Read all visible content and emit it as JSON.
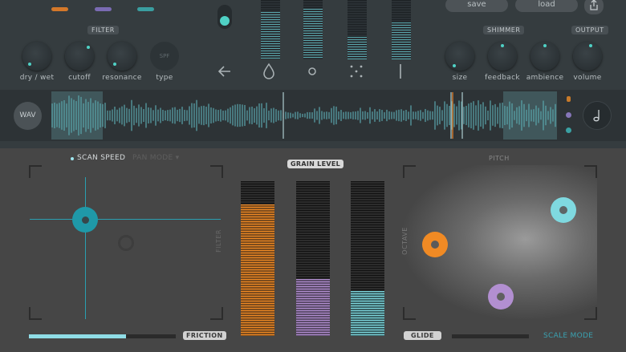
{
  "colors": {
    "teal": "#4fd1c5",
    "orange": "#f08a24",
    "lilac": "#b28fd1",
    "cyan": "#7fd9e0",
    "blue": "#1f99a8"
  },
  "top_tabs": [
    {
      "color": "#d4782a"
    },
    {
      "color": "#7a6bb3"
    },
    {
      "color": "#3a9ea0"
    }
  ],
  "filter": {
    "section_label": "FILTER",
    "knobs": [
      {
        "label": "dry / wet"
      },
      {
        "label": "cutoff"
      },
      {
        "label": "resonance"
      }
    ],
    "type_label": "type",
    "type_value": "SPF"
  },
  "shimmer": {
    "section_label": "SHIMMER",
    "knobs": [
      {
        "label": "size"
      },
      {
        "label": "feedback"
      },
      {
        "label": "ambience"
      }
    ]
  },
  "output": {
    "section_label": "OUTPUT",
    "knob": {
      "label": "volume"
    }
  },
  "buttons": {
    "save": "save",
    "load": "load"
  },
  "meters": {
    "levels": [
      0.8,
      0.85,
      0.4,
      0.6
    ]
  },
  "icons": [
    "back-arrow-icon",
    "drop-icon",
    "circle-icon",
    "scatter-icon",
    "line-icon"
  ],
  "waveform": {
    "wav_label": "WAV"
  },
  "scan": {
    "scan_speed_label": "SCAN SPEED",
    "pan_mode_label": "PAN MODE ▾",
    "friction_label": "FRICTION",
    "filter_axis_label": "FILTER",
    "friction_level": 0.66
  },
  "grain": {
    "label": "GRAIN LEVEL",
    "levels": [
      0.85,
      0.37,
      0.29
    ]
  },
  "pitch": {
    "label": "PITCH",
    "octave_label": "OCTAVE",
    "glide_label": "GLIDE",
    "scale_mode_label": "SCALE MODE",
    "glide_level": 0.0
  }
}
